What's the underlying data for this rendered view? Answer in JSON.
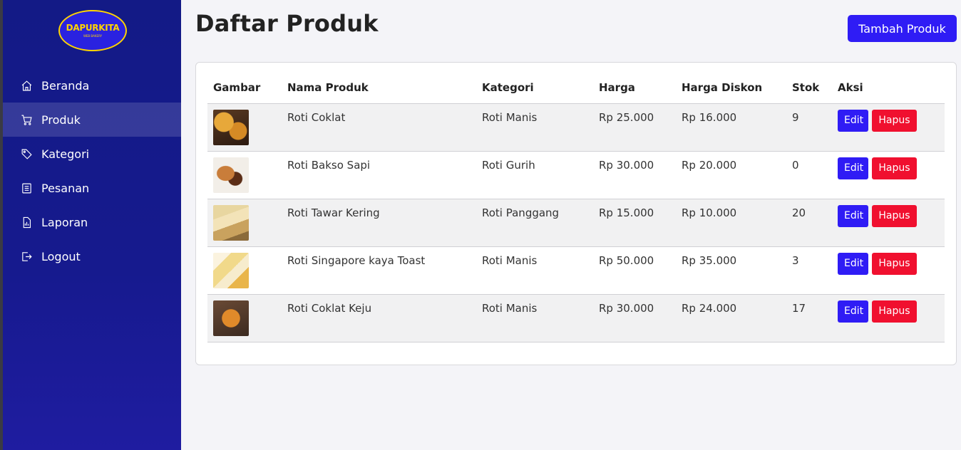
{
  "brand": {
    "name": "DAPURKITA",
    "tagline": "WEB BAKERY"
  },
  "sidebar": {
    "items": [
      {
        "label": "Beranda",
        "icon": "home-icon",
        "active": false
      },
      {
        "label": "Produk",
        "icon": "cart-icon",
        "active": true
      },
      {
        "label": "Kategori",
        "icon": "tag-icon",
        "active": false
      },
      {
        "label": "Pesanan",
        "icon": "list-icon",
        "active": false
      },
      {
        "label": "Laporan",
        "icon": "report-icon",
        "active": false
      },
      {
        "label": "Logout",
        "icon": "logout-icon",
        "active": false
      }
    ]
  },
  "header": {
    "title": "Daftar Produk",
    "add_label": "Tambah Produk"
  },
  "table": {
    "columns": [
      "Gambar",
      "Nama Produk",
      "Kategori",
      "Harga",
      "Harga Diskon",
      "Stok",
      "Aksi"
    ],
    "rows": [
      {
        "name": "Roti Coklat",
        "category": "Roti Manis",
        "price": "Rp 25.000",
        "discount": "Rp 16.000",
        "stock": "9"
      },
      {
        "name": "Roti Bakso Sapi",
        "category": "Roti Gurih",
        "price": "Rp 30.000",
        "discount": "Rp 20.000",
        "stock": "0"
      },
      {
        "name": "Roti Tawar Kering",
        "category": "Roti Panggang",
        "price": "Rp 15.000",
        "discount": "Rp 10.000",
        "stock": "20"
      },
      {
        "name": "Roti Singapore kaya Toast",
        "category": "Roti Manis",
        "price": "Rp 50.000",
        "discount": "Rp 35.000",
        "stock": "3"
      },
      {
        "name": "Roti Coklat Keju",
        "category": "Roti Manis",
        "price": "Rp 30.000",
        "discount": "Rp 24.000",
        "stock": "17"
      }
    ],
    "edit_label": "Edit",
    "delete_label": "Hapus"
  },
  "colors": {
    "sidebar": "#161a8e",
    "primary": "#2f1cf5",
    "danger": "#f0102f",
    "logo_accent": "#ffd400"
  }
}
